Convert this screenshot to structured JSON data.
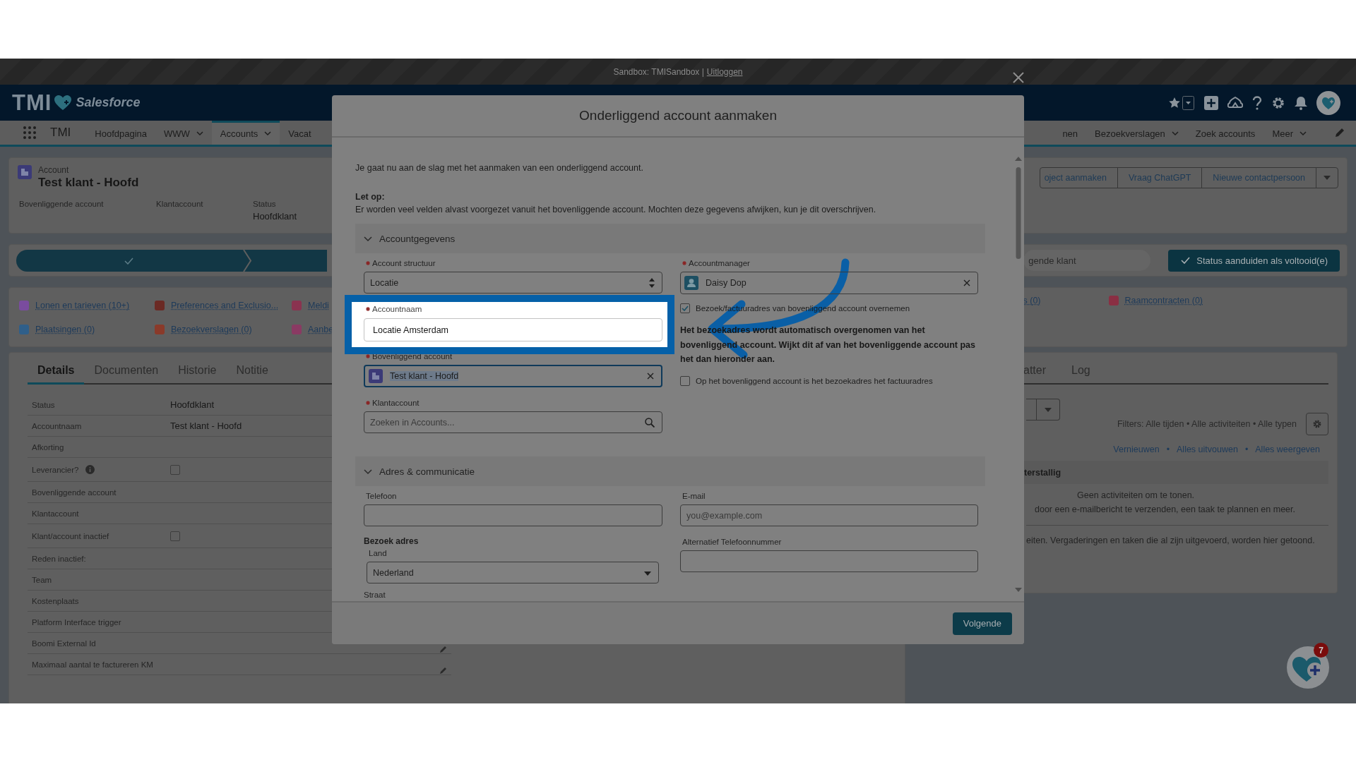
{
  "sandbox_bar": {
    "text": "Sandbox: TMISandbox |",
    "link": "Uitloggen"
  },
  "header": {
    "logo_text": "TMI",
    "brand": "Salesforce"
  },
  "nav": {
    "app_name": "TMI",
    "items_left": [
      {
        "label": "Hoofdpagina",
        "dropdown": false,
        "selected": false
      },
      {
        "label": "WWW",
        "dropdown": true,
        "selected": false
      },
      {
        "label": "Accounts",
        "dropdown": true,
        "selected": true
      },
      {
        "label": "Vacat",
        "dropdown": false,
        "selected": false
      }
    ],
    "items_right": [
      {
        "label": "nen",
        "dropdown": false,
        "selected": false
      },
      {
        "label": "Bezoekverslagen",
        "dropdown": true,
        "selected": false
      },
      {
        "label": "Zoek accounts",
        "dropdown": false,
        "selected": false
      },
      {
        "label": "Meer",
        "dropdown": true,
        "selected": false
      }
    ]
  },
  "record": {
    "type": "Account",
    "title": "Test klant - Hoofd",
    "fields": [
      {
        "label": "Bovenliggende account"
      },
      {
        "label": "Klantaccount"
      },
      {
        "label": "Status",
        "value": "Hoofdklant"
      }
    ],
    "actions": [
      "oject aanmaken",
      "Vraag ChatGPT",
      "Nieuwe contactpersoon"
    ]
  },
  "path": {
    "stage": "gende klant",
    "button": "Status aanduiden als voltooid(e)"
  },
  "related_links": [
    {
      "label": "Lonen en tarieven (10+)",
      "color": "#7a4c9e"
    },
    {
      "label": "Preferences and Exclusio...",
      "color": "#6b2a24"
    },
    {
      "label": "Meldi",
      "color": "#8a3350"
    },
    {
      "label": "Plaatsingen (0)",
      "color": "#2f5f8a"
    },
    {
      "label": "Bezoekverslagen (0)",
      "color": "#8a3a2a"
    },
    {
      "label": "Aanbe",
      "color": "#8a3a63"
    }
  ],
  "related_links_right": [
    {
      "label": "s (0)"
    },
    {
      "label": "Raamcontracten (0)",
      "color": "#8a2f43"
    }
  ],
  "detail_tabs": [
    {
      "label": "Details",
      "selected": true
    },
    {
      "label": "Documenten",
      "selected": false
    },
    {
      "label": "Historie",
      "selected": false
    },
    {
      "label": "Notitie",
      "selected": false
    }
  ],
  "detail_fields": [
    {
      "kind": "text",
      "label": "Status",
      "value": "Hoofdklant"
    },
    {
      "kind": "text",
      "label": "Accountnaam",
      "value": "Test klant - Hoofd"
    },
    {
      "kind": "text",
      "label": "Afkorting"
    },
    {
      "kind": "checkbox",
      "label": "Leverancier?",
      "info": true,
      "checked": false
    },
    {
      "kind": "text",
      "label": "Bovenliggende account"
    },
    {
      "kind": "text",
      "label": "Klantaccount"
    },
    {
      "kind": "checkbox",
      "label": "Klant/account inactief",
      "info": false,
      "checked": false
    },
    {
      "kind": "text",
      "label": "Reden inactief:"
    },
    {
      "kind": "text",
      "label": "Team"
    },
    {
      "kind": "text",
      "label": "Kostenplaats"
    },
    {
      "kind": "text",
      "label": "Platform Interface trigger"
    },
    {
      "kind": "text",
      "label": "Boomi External Id",
      "editable": true
    },
    {
      "kind": "text",
      "label": "Maximaal aantal te factureren KM",
      "editable": true
    }
  ],
  "activity": {
    "tabs": [
      {
        "label": "atter",
        "selected": false
      },
      {
        "label": "Log",
        "selected": false
      }
    ],
    "filters": "Filters: Alle tijden • Alle activiteiten • Alle typen",
    "links": [
      "Vernieuwen",
      "•",
      "Alles uitvouwen",
      "•",
      "Alles weergeven"
    ],
    "section": "terstallig",
    "empty_title": "Geen activiteiten om te tonen.",
    "empty_hint": "door een e-mailbericht te verzenden, een taak te plannen en meer.",
    "past_hint": "eiten. Vergaderingen en taken die al zijn uitgevoerd, worden hier getoond."
  },
  "notification_count": "7",
  "modal": {
    "title": "Onderliggend account aanmaken",
    "intro": "Je gaat nu aan de slag met het aanmaken van een onderliggend account.",
    "note_title": "Let op:",
    "note": "Er worden veel velden alvast voorgezet vanuit het bovenliggende account. Mochten deze gegevens afwijken, kun je dit overschrijven.",
    "sections": [
      {
        "title": "Accountgegevens",
        "expanded": true,
        "left": [
          {
            "kind": "select",
            "label": "Account structuur",
            "required": true,
            "value": "Locatie"
          },
          {
            "kind": "text",
            "label": "Accountnaam",
            "required": true,
            "value": "Locatie Amsterdam",
            "highlighted": true
          },
          {
            "kind": "lookup",
            "label": "Bovenliggend account",
            "required": true,
            "value": "Test klant - Hoofd",
            "focused": true
          },
          {
            "kind": "search",
            "label": "Klantaccount",
            "required": true,
            "placeholder": "Zoeken in Accounts..."
          }
        ],
        "right": [
          {
            "kind": "userlookup",
            "label": "Accountmanager",
            "required": true,
            "value": "Daisy Dop",
            "focused": false
          },
          {
            "kind": "checkbox",
            "label": "Bezoek/factuuradres van bovenliggend account overnemen",
            "checked": true
          },
          {
            "kind": "paragraph",
            "text": "Het bezoekadres wordt automatisch overgenomen van het bovenliggend account. Wijkt dit af van het bovenliggende account pas het dan hieronder aan."
          },
          {
            "kind": "checkbox",
            "label": "Op het bovenliggend account is het bezoekadres het factuuradres",
            "checked": false
          }
        ]
      },
      {
        "title": "Adres & communicatie",
        "expanded": true,
        "left": [
          {
            "kind": "text",
            "label": "Telefoon",
            "required": false,
            "highlighted": false
          },
          {
            "kind": "subheading",
            "text": "Bezoek adres"
          },
          {
            "kind": "dropdown",
            "label": "Land",
            "required": false,
            "value": "Nederland"
          },
          {
            "kind": "label",
            "text": "Straat"
          }
        ],
        "right": [
          {
            "kind": "text",
            "label": "E-mail",
            "required": false,
            "placeholder": "you@example.com",
            "highlighted": false
          },
          {
            "kind": "text",
            "label": "Alternatief Telefoonnummer",
            "required": false,
            "highlighted": false
          }
        ]
      }
    ],
    "primary_button": "Volgende"
  }
}
